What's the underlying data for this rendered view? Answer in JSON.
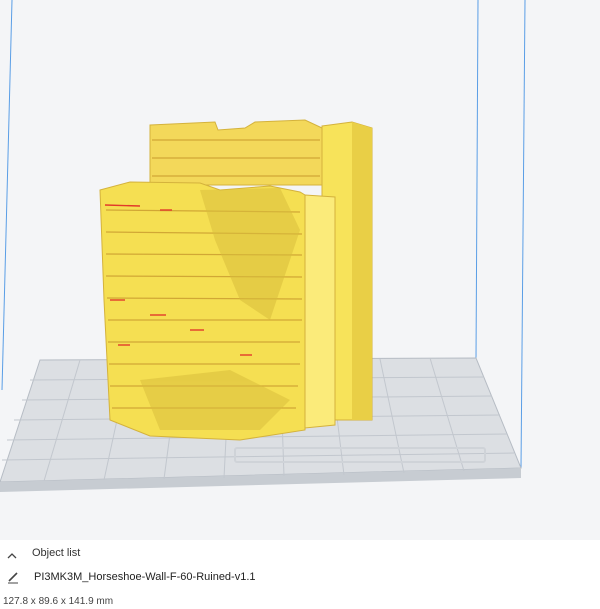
{
  "object_panel": {
    "header_label": "Object list",
    "object_name": "PI3MK3M_Horseshoe-Wall-F-60-Ruined-v1.1",
    "dimensions": "127.8 x 89.6 x 141.9 mm"
  },
  "icons": {
    "collapse": "chevron-up-icon",
    "edit": "pencil-icon"
  },
  "colors": {
    "model": "#f7e35a",
    "build_plate": "#dcdfe3",
    "volume_edge": "#3c8de0",
    "viewport_bg": "#f4f5f7"
  }
}
